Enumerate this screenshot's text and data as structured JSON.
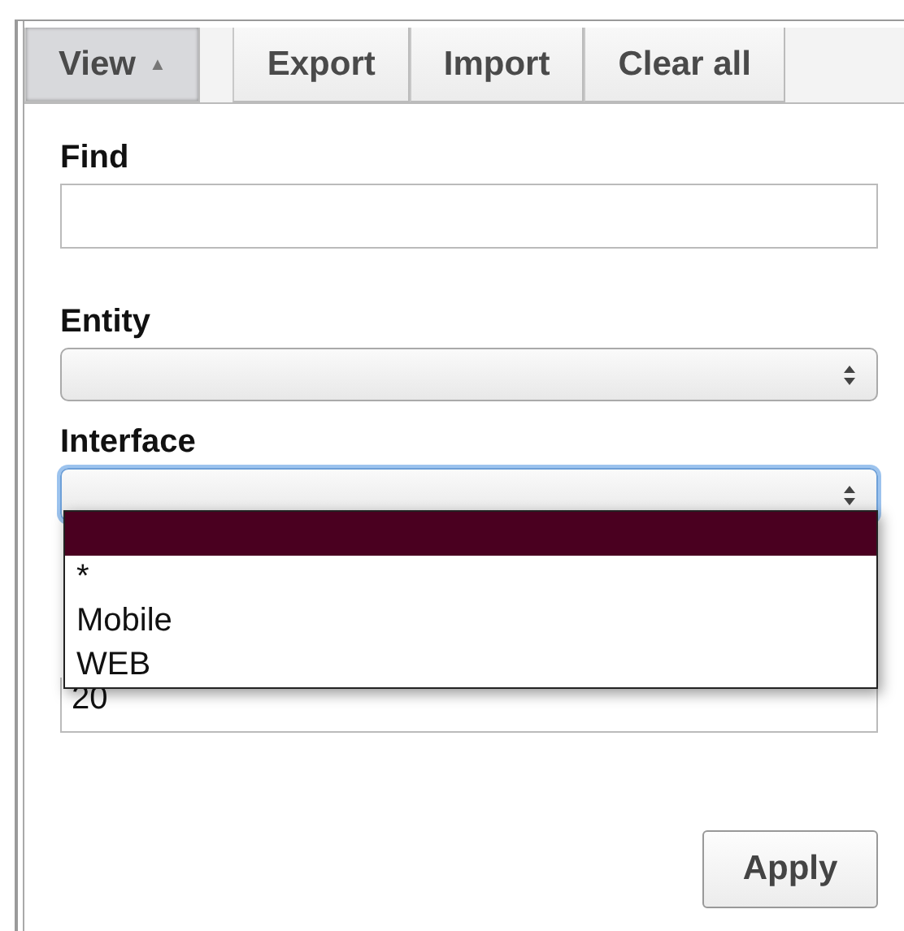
{
  "toolbar": [
    {
      "label": "View",
      "pressed": true,
      "caret": "▲"
    },
    {
      "label": "Export",
      "pressed": false
    },
    {
      "label": "Import",
      "pressed": false
    },
    {
      "label": "Clear all",
      "pressed": false
    }
  ],
  "find": {
    "label": "Find"
  },
  "entity": {
    "label": "Entity"
  },
  "interface": {
    "label": "Interface",
    "focused": true,
    "options": [
      {
        "selected": true
      },
      {
        "label": "*",
        "selected": false
      },
      {
        "label": "Mobile",
        "selected": false
      },
      {
        "label": "WEB",
        "selected": false
      }
    ]
  },
  "hidden_field": {
    "value": "20"
  },
  "apply": "Apply"
}
